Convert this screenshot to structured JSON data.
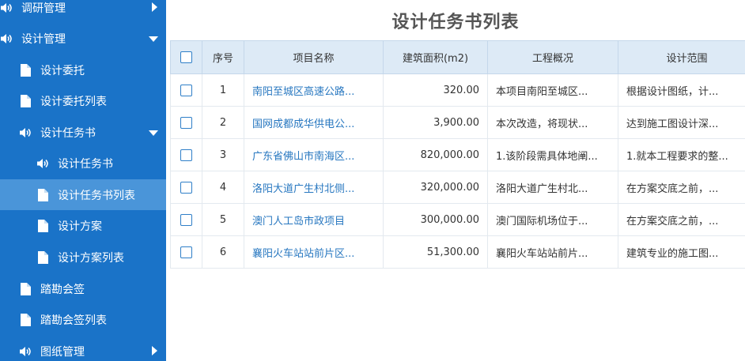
{
  "sidebar": {
    "items": [
      {
        "label": "调研管理",
        "icon": "speaker-icon",
        "arrow": "right"
      },
      {
        "label": "设计管理",
        "icon": "speaker-icon",
        "arrow": "down"
      },
      {
        "label": "设计委托",
        "icon": "document-icon"
      },
      {
        "label": "设计委托列表",
        "icon": "document-icon"
      },
      {
        "label": "设计任务书",
        "icon": "speaker-icon",
        "arrow": "down"
      },
      {
        "label": "设计任务书",
        "icon": "speaker-icon"
      },
      {
        "label": "设计任务书列表",
        "icon": "document-icon",
        "active": true
      },
      {
        "label": "设计方案",
        "icon": "document-icon"
      },
      {
        "label": "设计方案列表",
        "icon": "document-icon"
      },
      {
        "label": "踏勘会签",
        "icon": "document-icon"
      },
      {
        "label": "踏勘会签列表",
        "icon": "document-icon"
      },
      {
        "label": "图纸管理",
        "icon": "speaker-icon",
        "arrow": "right"
      }
    ]
  },
  "main": {
    "title": "设计任务书列表",
    "table": {
      "headers": [
        "序号",
        "项目名称",
        "建筑面积(m2)",
        "工程概况",
        "设计范围"
      ],
      "rows": [
        {
          "index": "1",
          "name": "南阳至城区高速公路...",
          "area": "320.00",
          "overview": "本项目南阳至城区...",
          "scope": "根据设计图纸，计..."
        },
        {
          "index": "2",
          "name": "国网成都成华供电公...",
          "area": "3,900.00",
          "overview": "本次改造，将现状...",
          "scope": "达到施工图设计深..."
        },
        {
          "index": "3",
          "name": "广东省佛山市南海区...",
          "area": "820,000.00",
          "overview": "1.该阶段需具体地阐...",
          "scope": "1.就本工程要求的整..."
        },
        {
          "index": "4",
          "name": "洛阳大道广生村北侧...",
          "area": "320,000.00",
          "overview": "洛阳大道广生村北...",
          "scope": "在方案交底之前，..."
        },
        {
          "index": "5",
          "name": "澳门人工岛市政项目",
          "area": "300,000.00",
          "overview": "澳门国际机场位于...",
          "scope": "在方案交底之前，..."
        },
        {
          "index": "6",
          "name": "襄阳火车站站前片区...",
          "area": "51,300.00",
          "overview": "襄阳火车站站前片...",
          "scope": "建筑专业的施工图..."
        }
      ]
    }
  },
  "colors": {
    "sidebar_bg": "#1a73c8",
    "sidebar_active": "#4a95d9",
    "header_bg": "#ddeaf6",
    "link": "#2777c0"
  }
}
